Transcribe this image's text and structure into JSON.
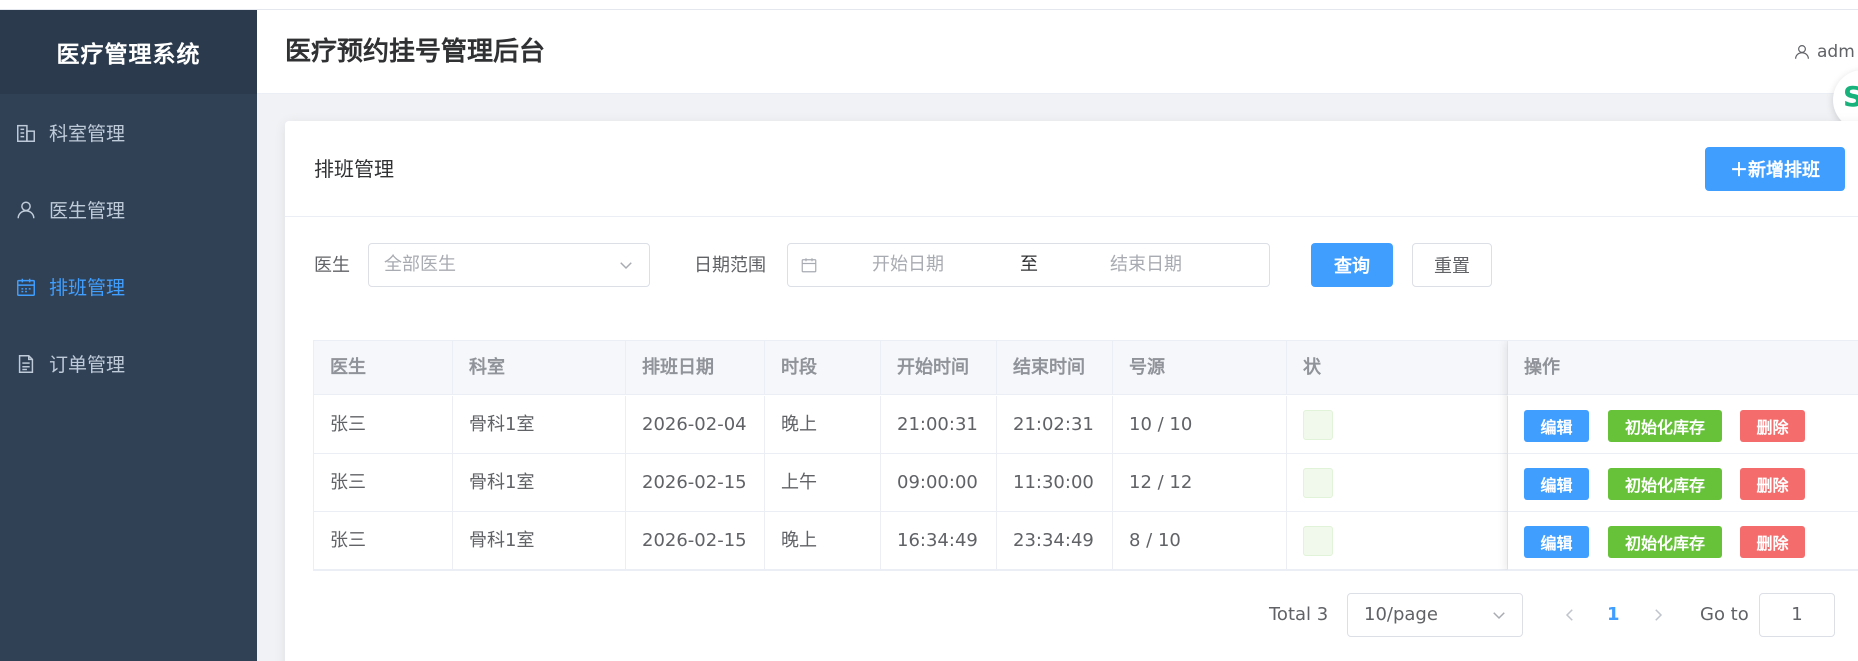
{
  "app": {
    "logo": "医疗管理系统",
    "header_title": "医疗预约挂号管理后台",
    "user": "adm",
    "float_glyph": "S"
  },
  "sidebar": {
    "items": [
      {
        "label": "科室管理",
        "icon": "building-icon",
        "active": false
      },
      {
        "label": "医生管理",
        "icon": "user-icon",
        "active": false
      },
      {
        "label": "排班管理",
        "icon": "calendar-icon",
        "active": true
      },
      {
        "label": "订单管理",
        "icon": "document-icon",
        "active": false
      }
    ]
  },
  "card": {
    "title": "排班管理",
    "add_button": "＋新增排班"
  },
  "filter": {
    "doctor_label": "医生",
    "doctor_placeholder": "全部医生",
    "date_label": "日期范围",
    "start_placeholder": "开始日期",
    "separator": "至",
    "end_placeholder": "结束日期",
    "query_button": "查询",
    "reset_button": "重置"
  },
  "table": {
    "headers": [
      "医生",
      "科室",
      "排班日期",
      "时段",
      "开始时间",
      "结束时间",
      "号源",
      "状",
      "操作"
    ],
    "rows": [
      [
        "张三",
        "骨科1室",
        "2026-02-04",
        "晚上",
        "21:00:31",
        "21:02:31",
        "10 / 10"
      ],
      [
        "张三",
        "骨科1室",
        "2026-02-15",
        "上午",
        "09:00:00",
        "11:30:00",
        "12 / 12"
      ],
      [
        "张三",
        "骨科1室",
        "2026-02-15",
        "晚上",
        "16:34:49",
        "23:34:49",
        "8 / 10"
      ]
    ],
    "actions": {
      "edit": "编辑",
      "init": "初始化库存",
      "delete": "删除"
    }
  },
  "pagination": {
    "total": "Total 3",
    "page_size": "10/page",
    "current_page": "1",
    "goto_label": "Go to",
    "goto_value": "1"
  },
  "colors": {
    "sidebar_bg": "#304156",
    "primary": "#409eff",
    "success": "#67c23a",
    "danger": "#f56c6c"
  }
}
